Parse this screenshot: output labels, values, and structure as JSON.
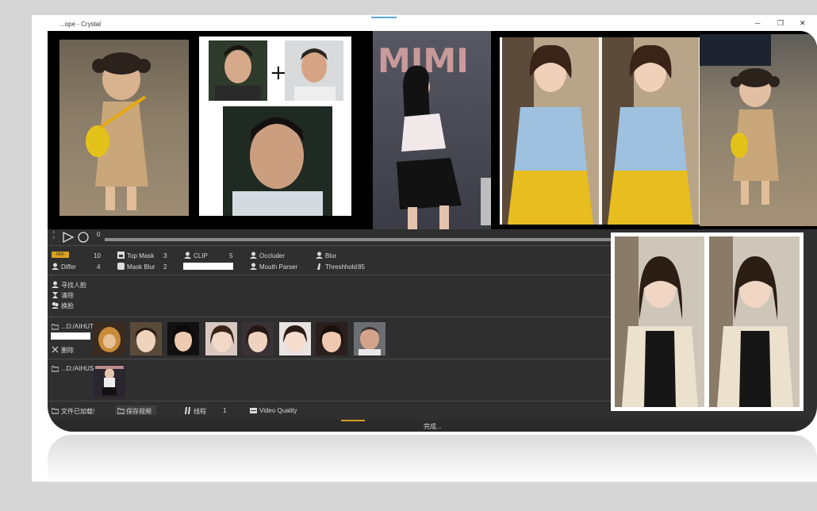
{
  "window": {
    "title": "...ope - Crystal",
    "minimize": "─",
    "restore": "❐"
  },
  "transport": {
    "frame": "0"
  },
  "params": {
    "logo_text": "OFF",
    "differ_label": "Differ",
    "differ_value": "4",
    "value_1": "10",
    "top_mask_label": "Top Mask",
    "top_mask_value": "3",
    "mask_blur_label": "Mask Blur",
    "mask_blur_value": "2",
    "clip_label": "CLIP",
    "clip_value": "5",
    "occluder_label": "Occluder",
    "mouth_parser_label": "Mouth Parser",
    "blur_label": "Blur",
    "threshold_label": "Threshhold",
    "threshold_value": "85"
  },
  "actions": {
    "find_faces": "寻找人脸",
    "clear": "清除",
    "swap": "换脸"
  },
  "source_faces": {
    "path": "...D:/AIHUT",
    "delete_label": "删除"
  },
  "target_videos": {
    "path": "...D:/AIHUS"
  },
  "bottom_bar": {
    "file_loaded": "文件已加载!",
    "save_video": "保存视频",
    "threads_label": "线程",
    "threads_value": "1",
    "video_quality_label": "Video Quality"
  },
  "status": {
    "text": "完成..."
  },
  "colors": {
    "panel": "#2f2f2f",
    "accent": "#d7a01f",
    "title_accent": "#5aa6d8"
  }
}
